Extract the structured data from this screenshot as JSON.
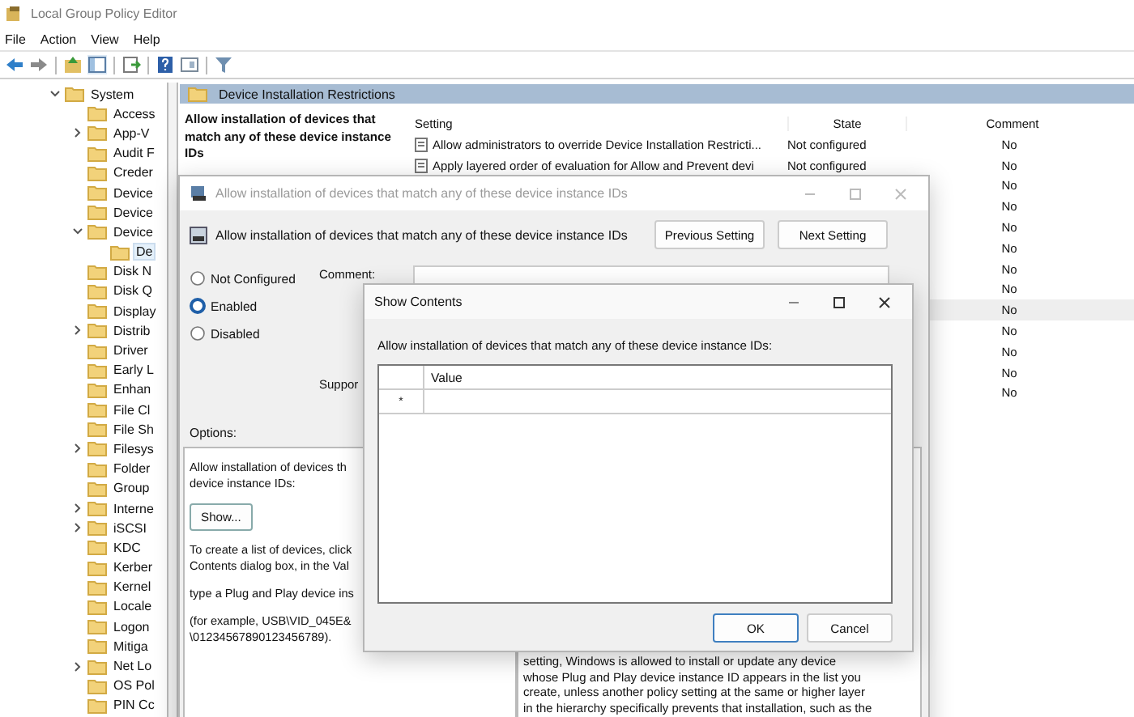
{
  "window": {
    "title": "Local Group Policy Editor"
  },
  "menu": [
    "File",
    "Action",
    "View",
    "Help"
  ],
  "tree": [
    {
      "label": "System",
      "expanded": true,
      "selected": false,
      "children": [
        {
          "label": "Access",
          "selected": false
        },
        {
          "label": "App-V",
          "expanded": false,
          "selected": false
        },
        {
          "label": "Audit F",
          "selected": false
        },
        {
          "label": "Creder",
          "selected": false
        },
        {
          "label": "Device",
          "selected": false
        },
        {
          "label": "Device",
          "selected": false
        },
        {
          "label": "Device",
          "expanded": true,
          "selected": false,
          "children": [
            {
              "label": "De",
              "selected": true
            }
          ]
        },
        {
          "label": "Disk N",
          "selected": false
        },
        {
          "label": "Disk Q",
          "selected": false
        },
        {
          "label": "Display",
          "selected": false
        },
        {
          "label": "Distrib",
          "expanded": false,
          "selected": false
        },
        {
          "label": "Driver",
          "selected": false
        },
        {
          "label": "Early L",
          "selected": false
        },
        {
          "label": "Enhan",
          "selected": false
        },
        {
          "label": "File Cl",
          "selected": false
        },
        {
          "label": "File Sh",
          "selected": false
        },
        {
          "label": "Filesys",
          "expanded": false,
          "selected": false
        },
        {
          "label": "Folder",
          "selected": false
        },
        {
          "label": "Group",
          "selected": false
        },
        {
          "label": "Interne",
          "expanded": false,
          "selected": false
        },
        {
          "label": "iSCSI",
          "expanded": false,
          "selected": false
        },
        {
          "label": "KDC",
          "selected": false
        },
        {
          "label": "Kerber",
          "selected": false
        },
        {
          "label": "Kernel",
          "selected": false
        },
        {
          "label": "Locale",
          "selected": false
        },
        {
          "label": "Logon",
          "selected": false
        },
        {
          "label": "Mitiga",
          "selected": false
        },
        {
          "label": "Net Lo",
          "expanded": false,
          "selected": false
        },
        {
          "label": "OS Pol",
          "selected": false
        },
        {
          "label": "PIN Cc",
          "selected": false
        }
      ]
    }
  ],
  "details": {
    "header": "Device Installation Restrictions",
    "description": "Allow installation of devices that match any of these device instance IDs",
    "columns": [
      "Setting",
      "State",
      "Comment"
    ],
    "rows": [
      {
        "setting": "Allow administrators to override Device Installation Restricti...",
        "state": "Not configured",
        "comment": "No",
        "selected": false
      },
      {
        "setting": "Apply layered order of evaluation for Allow and Prevent devi",
        "state": "Not configured",
        "comment": "No",
        "selected": false
      },
      {
        "comment": "No",
        "selected": false
      },
      {
        "comment": "No",
        "selected": false
      },
      {
        "comment": "No",
        "selected": false
      },
      {
        "comment": "No",
        "selected": false
      },
      {
        "comment": "No",
        "selected": false
      },
      {
        "comment": "No",
        "selected": false
      },
      {
        "comment": "No",
        "selected": true
      },
      {
        "comment": "No",
        "selected": false
      },
      {
        "comment": "No",
        "selected": false
      },
      {
        "comment": "No",
        "selected": false
      },
      {
        "comment": "No",
        "selected": false
      }
    ]
  },
  "policy_dialog": {
    "title": "Allow installation of devices that match any of these device instance IDs",
    "heading": "Allow installation of devices that match any of these device instance IDs",
    "buttons": [
      "Previous Setting",
      "Next Setting"
    ],
    "states": [
      {
        "label": "Not Configured",
        "selected": false
      },
      {
        "label": "Enabled",
        "selected": true
      },
      {
        "label": "Disabled",
        "selected": false
      }
    ],
    "comment_label": "Comment:",
    "supported_label": "Suppor",
    "options_label": "Options:",
    "options": [
      {
        "kind": "text",
        "lines": [
          "Allow installation of devices th",
          "device instance IDs:"
        ]
      },
      {
        "kind": "button",
        "label": "Show..."
      },
      {
        "kind": "text",
        "lines": [
          "To create a list of devices, click",
          "Contents dialog box, in the Val"
        ]
      },
      {
        "kind": "text",
        "lines": [
          "type a Plug and Play device ins"
        ]
      },
      {
        "kind": "text",
        "lines": [
          "(for example, USB\\VID_045E&",
          "\\01234567890123456789)."
        ]
      }
    ],
    "help_lines": [
      "setting, Windows is allowed to install or update any device",
      "whose Plug and Play device instance ID appears in the list you",
      "create, unless another policy setting at the same or higher layer",
      "in the hierarchy specifically prevents that installation, such as the"
    ]
  },
  "show_contents": {
    "title": "Show Contents",
    "prompt": "Allow installation of devices that match any of these device instance IDs:",
    "column": "Value",
    "rows": [
      {
        "marker": "*"
      }
    ],
    "buttons": [
      {
        "label": "OK",
        "default": true
      },
      {
        "label": "Cancel",
        "default": false
      }
    ]
  }
}
